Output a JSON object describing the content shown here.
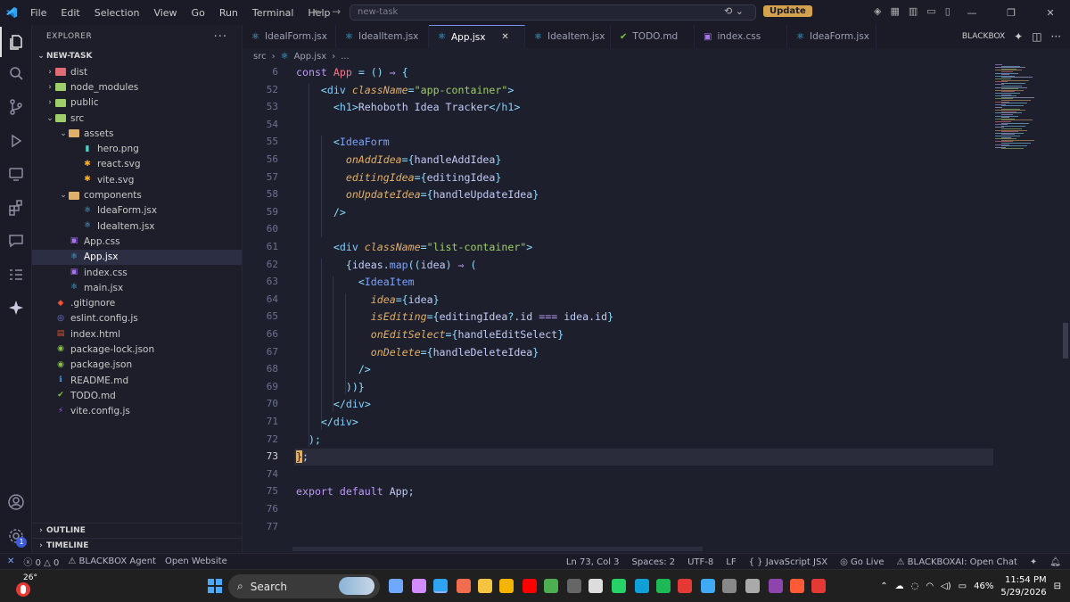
{
  "titlebar": {
    "menu": [
      "File",
      "Edit",
      "Selection",
      "View",
      "Go",
      "Run",
      "Terminal",
      "Help"
    ],
    "command_center": "new-task",
    "update_label": "Update"
  },
  "sidebar": {
    "title": "EXPLORER",
    "project": "NEW-TASK",
    "tree": [
      {
        "label": "dist",
        "depth": 0,
        "type": "folder",
        "open": false,
        "color": "#e06c75"
      },
      {
        "label": "node_modules",
        "depth": 0,
        "type": "folder",
        "open": false,
        "color": "#9ece6a"
      },
      {
        "label": "public",
        "depth": 0,
        "type": "folder",
        "open": false,
        "color": "#9ece6a"
      },
      {
        "label": "src",
        "depth": 0,
        "type": "folder",
        "open": true,
        "color": "#9ece6a"
      },
      {
        "label": "assets",
        "depth": 1,
        "type": "folder",
        "open": true,
        "color": "#e0af68"
      },
      {
        "label": "hero.png",
        "depth": 2,
        "type": "file",
        "icon": "image-icon",
        "glyph": "▮",
        "color": "#4fd1c5"
      },
      {
        "label": "react.svg",
        "depth": 2,
        "type": "file",
        "icon": "svg-icon",
        "glyph": "✱",
        "color": "#ffb020"
      },
      {
        "label": "vite.svg",
        "depth": 2,
        "type": "file",
        "icon": "svg-icon",
        "glyph": "✱",
        "color": "#ffb020"
      },
      {
        "label": "components",
        "depth": 1,
        "type": "folder",
        "open": true,
        "color": "#e0af68"
      },
      {
        "label": "IdeaForm.jsx",
        "depth": 2,
        "type": "file",
        "icon": "react-icon",
        "glyph": "⚛",
        "color": "#4fc3f7"
      },
      {
        "label": "IdeaItem.jsx",
        "depth": 2,
        "type": "file",
        "icon": "react-icon",
        "glyph": "⚛",
        "color": "#4fc3f7"
      },
      {
        "label": "App.css",
        "depth": 1,
        "type": "file",
        "icon": "css-icon",
        "glyph": "▣",
        "color": "#a873f0"
      },
      {
        "label": "App.jsx",
        "depth": 1,
        "type": "file",
        "icon": "react-icon",
        "glyph": "⚛",
        "color": "#4fc3f7",
        "selected": true
      },
      {
        "label": "index.css",
        "depth": 1,
        "type": "file",
        "icon": "css-icon",
        "glyph": "▣",
        "color": "#a873f0"
      },
      {
        "label": "main.jsx",
        "depth": 1,
        "type": "file",
        "icon": "react-icon",
        "glyph": "⚛",
        "color": "#4fc3f7"
      },
      {
        "label": ".gitignore",
        "depth": 0,
        "type": "file",
        "icon": "git-icon",
        "glyph": "◆",
        "color": "#f05033"
      },
      {
        "label": "eslint.config.js",
        "depth": 0,
        "type": "file",
        "icon": "eslint-icon",
        "glyph": "◎",
        "color": "#8080f0"
      },
      {
        "label": "index.html",
        "depth": 0,
        "type": "file",
        "icon": "html-icon",
        "glyph": "▤",
        "color": "#e44d26"
      },
      {
        "label": "package-lock.json",
        "depth": 0,
        "type": "file",
        "icon": "npm-icon",
        "glyph": "◉",
        "color": "#8bc34a"
      },
      {
        "label": "package.json",
        "depth": 0,
        "type": "file",
        "icon": "npm-icon",
        "glyph": "◉",
        "color": "#8bc34a"
      },
      {
        "label": "README.md",
        "depth": 0,
        "type": "file",
        "icon": "info-icon",
        "glyph": "ℹ",
        "color": "#42a5f5"
      },
      {
        "label": "TODO.md",
        "depth": 0,
        "type": "file",
        "icon": "check-icon",
        "glyph": "✔",
        "color": "#7cc342"
      },
      {
        "label": "vite.config.js",
        "depth": 0,
        "type": "file",
        "icon": "vite-icon",
        "glyph": "⚡",
        "color": "#a855f7"
      }
    ],
    "outline": "OUTLINE",
    "timeline": "TIMELINE",
    "badge": "1"
  },
  "tabs": [
    {
      "label": "IdealForm.jsx",
      "icon": "react-icon"
    },
    {
      "label": "IdealItem.jsx",
      "icon": "react-icon"
    },
    {
      "label": "App.jsx",
      "icon": "react-icon",
      "active": true
    },
    {
      "label": "IdeaItem.jsx",
      "icon": "react-icon"
    },
    {
      "label": "TODO.md",
      "icon": "check-icon"
    },
    {
      "label": "index.css",
      "icon": "css-icon"
    },
    {
      "label": "IdeaForm.jsx",
      "icon": "react-icon"
    }
  ],
  "tabbar_right": "BLACKBOX",
  "breadcrumb": [
    "src",
    "App.jsx",
    "..."
  ],
  "code": {
    "current_line": "73",
    "lines": [
      {
        "n": "6",
        "seg": [
          [
            "k",
            "const "
          ],
          [
            "f",
            "App"
          ],
          [
            "o",
            " = () "
          ],
          [
            "k",
            "⇒"
          ],
          [
            "p",
            " {"
          ]
        ]
      },
      {
        "n": "52",
        "seg": [
          [
            "v",
            "    "
          ],
          [
            "p",
            "<"
          ],
          [
            "t",
            "div "
          ],
          [
            "a",
            "className"
          ],
          [
            "p",
            "="
          ],
          [
            "s",
            "\"app-container\""
          ],
          [
            "p",
            ">"
          ]
        ]
      },
      {
        "n": "53",
        "seg": [
          [
            "v",
            "      "
          ],
          [
            "p",
            "<"
          ],
          [
            "t",
            "h1"
          ],
          [
            "p",
            ">"
          ],
          [
            "v",
            "Rehoboth Idea Tracker"
          ],
          [
            "p",
            "</"
          ],
          [
            "t",
            "h1"
          ],
          [
            "p",
            ">"
          ]
        ]
      },
      {
        "n": "54",
        "seg": []
      },
      {
        "n": "55",
        "seg": [
          [
            "v",
            "      "
          ],
          [
            "p",
            "<"
          ],
          [
            "m",
            "IdeaForm"
          ]
        ]
      },
      {
        "n": "56",
        "seg": [
          [
            "v",
            "        "
          ],
          [
            "a",
            "onAddIdea"
          ],
          [
            "p",
            "={"
          ],
          [
            "v",
            "handleAddIdea"
          ],
          [
            "p",
            "}"
          ]
        ]
      },
      {
        "n": "57",
        "seg": [
          [
            "v",
            "        "
          ],
          [
            "a",
            "editingIdea"
          ],
          [
            "p",
            "={"
          ],
          [
            "v",
            "editingIdea"
          ],
          [
            "p",
            "}"
          ]
        ]
      },
      {
        "n": "58",
        "seg": [
          [
            "v",
            "        "
          ],
          [
            "a",
            "onUpdateIdea"
          ],
          [
            "p",
            "={"
          ],
          [
            "v",
            "handleUpdateIdea"
          ],
          [
            "p",
            "}"
          ]
        ]
      },
      {
        "n": "59",
        "seg": [
          [
            "v",
            "      "
          ],
          [
            "p",
            "/>"
          ]
        ]
      },
      {
        "n": "60",
        "seg": []
      },
      {
        "n": "61",
        "seg": [
          [
            "v",
            "      "
          ],
          [
            "p",
            "<"
          ],
          [
            "t",
            "div "
          ],
          [
            "a",
            "className"
          ],
          [
            "p",
            "="
          ],
          [
            "s",
            "\"list-container\""
          ],
          [
            "p",
            ">"
          ]
        ]
      },
      {
        "n": "62",
        "seg": [
          [
            "v",
            "        "
          ],
          [
            "p",
            "{"
          ],
          [
            "v",
            "ideas."
          ],
          [
            "m",
            "map"
          ],
          [
            "p",
            "(("
          ],
          [
            "v",
            "idea"
          ],
          [
            "p",
            ") "
          ],
          [
            "k",
            "⇒"
          ],
          [
            "p",
            " ("
          ]
        ]
      },
      {
        "n": "63",
        "seg": [
          [
            "v",
            "          "
          ],
          [
            "p",
            "<"
          ],
          [
            "m",
            "IdeaItem"
          ]
        ]
      },
      {
        "n": "64",
        "seg": [
          [
            "v",
            "            "
          ],
          [
            "a",
            "idea"
          ],
          [
            "p",
            "={"
          ],
          [
            "v",
            "idea"
          ],
          [
            "p",
            "}"
          ]
        ]
      },
      {
        "n": "65",
        "seg": [
          [
            "v",
            "            "
          ],
          [
            "a",
            "isEditing"
          ],
          [
            "p",
            "={"
          ],
          [
            "v",
            "editingIdea"
          ],
          [
            "p",
            "?."
          ],
          [
            "v",
            "id "
          ],
          [
            "k",
            "==="
          ],
          [
            "v",
            " idea.id"
          ],
          [
            "p",
            "}"
          ]
        ]
      },
      {
        "n": "66",
        "seg": [
          [
            "v",
            "            "
          ],
          [
            "a",
            "onEditSelect"
          ],
          [
            "p",
            "={"
          ],
          [
            "v",
            "handleEditSelect"
          ],
          [
            "p",
            "}"
          ]
        ]
      },
      {
        "n": "67",
        "seg": [
          [
            "v",
            "            "
          ],
          [
            "a",
            "onDelete"
          ],
          [
            "p",
            "={"
          ],
          [
            "v",
            "handleDeleteIdea"
          ],
          [
            "p",
            "}"
          ]
        ]
      },
      {
        "n": "68",
        "seg": [
          [
            "v",
            "          "
          ],
          [
            "p",
            "/>"
          ]
        ]
      },
      {
        "n": "69",
        "seg": [
          [
            "v",
            "        "
          ],
          [
            "p",
            "))}"
          ]
        ]
      },
      {
        "n": "70",
        "seg": [
          [
            "v",
            "      "
          ],
          [
            "p",
            "</"
          ],
          [
            "t",
            "div"
          ],
          [
            "p",
            ">"
          ]
        ]
      },
      {
        "n": "71",
        "seg": [
          [
            "v",
            "    "
          ],
          [
            "p",
            "</"
          ],
          [
            "t",
            "div"
          ],
          [
            "p",
            ">"
          ]
        ]
      },
      {
        "n": "72",
        "seg": [
          [
            "v",
            "  "
          ],
          [
            "p",
            ");"
          ]
        ]
      },
      {
        "n": "73",
        "seg": [
          [
            "y",
            "}"
          ],
          [
            "v",
            ";"
          ]
        ]
      },
      {
        "n": "74",
        "seg": []
      },
      {
        "n": "75",
        "seg": [
          [
            "k",
            "export default "
          ],
          [
            "v",
            "App;"
          ]
        ]
      },
      {
        "n": "76",
        "seg": []
      },
      {
        "n": "77",
        "seg": []
      }
    ]
  },
  "status": {
    "errors": "0",
    "warnings": "0",
    "blackbox_agent": "BLACKBOX Agent",
    "open_website": "Open Website",
    "position": "Ln 73, Col 3",
    "spaces": "Spaces: 2",
    "encoding": "UTF-8",
    "eol": "LF",
    "language": "JavaScript JSX",
    "golive": "Go Live",
    "blackboxai": "BLACKBOXAI: Open Chat"
  },
  "taskbar": {
    "temperature": "26°",
    "search": "Search",
    "battery": "46%",
    "time": "11:54 PM",
    "date": "5/29/2026"
  }
}
